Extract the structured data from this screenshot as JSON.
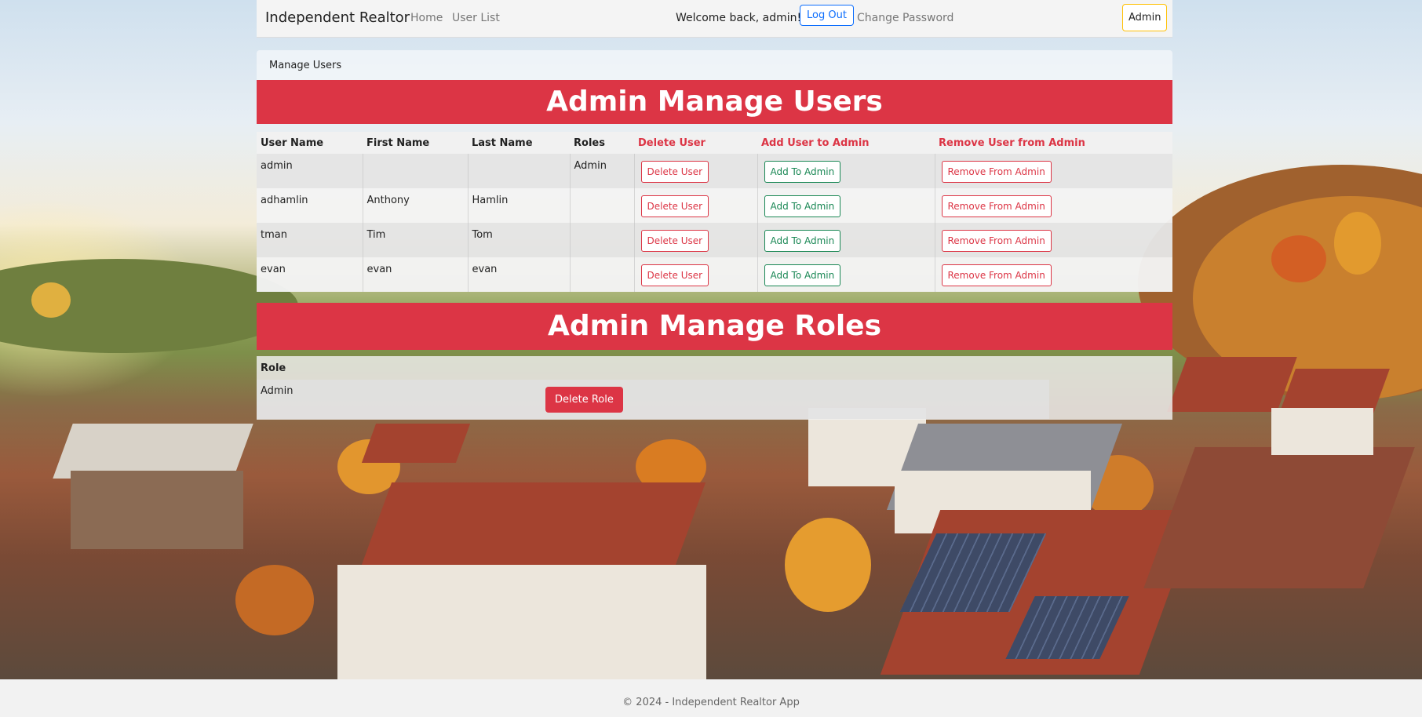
{
  "navbar": {
    "brand": "Independent Realtor",
    "links": [
      {
        "label": "Home"
      },
      {
        "label": "User List"
      }
    ],
    "welcome": "Welcome back, admin!",
    "logout_label": "Log Out",
    "change_password_label": "Change Password",
    "admin_label": "Admin",
    "colors": {
      "primary": "#0d6efd",
      "warning": "#ffc107"
    }
  },
  "breadcrumb": "Manage Users",
  "users_section": {
    "title": "Admin Manage Users",
    "columns": [
      "User Name",
      "First Name",
      "Last Name",
      "Roles",
      "Delete User",
      "Add User to Admin",
      "Remove User from Admin"
    ],
    "rows": [
      {
        "username": "admin",
        "first": "",
        "last": "",
        "roles": "Admin"
      },
      {
        "username": "adhamlin",
        "first": "Anthony",
        "last": "Hamlin",
        "roles": ""
      },
      {
        "username": "tman",
        "first": "Tim",
        "last": "Tom",
        "roles": ""
      },
      {
        "username": "evan",
        "first": "evan",
        "last": "evan",
        "roles": ""
      }
    ],
    "delete_label": "Delete User",
    "add_admin_label": "Add To Admin",
    "remove_admin_label": "Remove From Admin"
  },
  "roles_section": {
    "title": "Admin Manage Roles",
    "column": "Role",
    "rows": [
      {
        "name": "Admin"
      }
    ],
    "delete_role_label": "Delete Role"
  },
  "footer": "© 2024 - Independent Realtor App",
  "colors": {
    "danger": "#dc3545",
    "success": "#198754"
  }
}
